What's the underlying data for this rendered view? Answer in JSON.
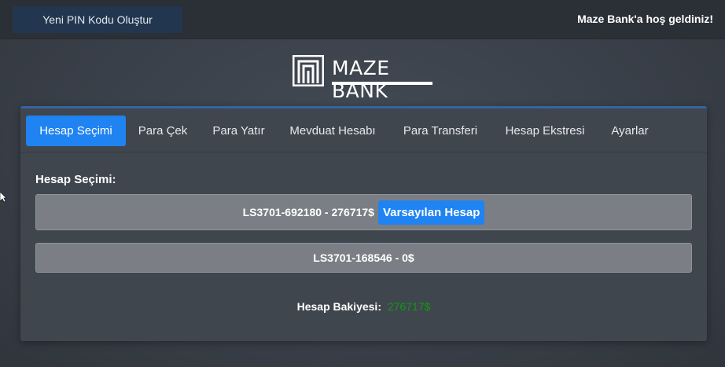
{
  "header": {
    "pin_button_label": "Yeni PIN Kodu Oluştur",
    "welcome_text": "Maze Bank'a hoş geldiniz!"
  },
  "logo": {
    "text": "MAZE BANK",
    "icon": "maze-bank-logo-icon"
  },
  "tabs": [
    {
      "label": "Hesap Seçimi",
      "active": true
    },
    {
      "label": "Para Çek",
      "active": false
    },
    {
      "label": "Para Yatır",
      "active": false
    },
    {
      "label": "Mevduat Hesabı",
      "active": false
    },
    {
      "label": "Para Transferi",
      "active": false
    },
    {
      "label": "Hesap Ekstresi",
      "active": false
    },
    {
      "label": "Ayarlar",
      "active": false
    }
  ],
  "account_selection": {
    "title": "Hesap Seçimi:",
    "accounts": [
      {
        "label": "LS3701-692180 - 276717$",
        "badge": "Varsayılan Hesap"
      },
      {
        "label": "LS3701-168546 - 0$"
      }
    ],
    "balance_label": "Hesap Bakiyesi:",
    "balance_value": "276717$"
  },
  "colors": {
    "accent": "#1f83f1",
    "balance_value": "#0f9a12"
  }
}
